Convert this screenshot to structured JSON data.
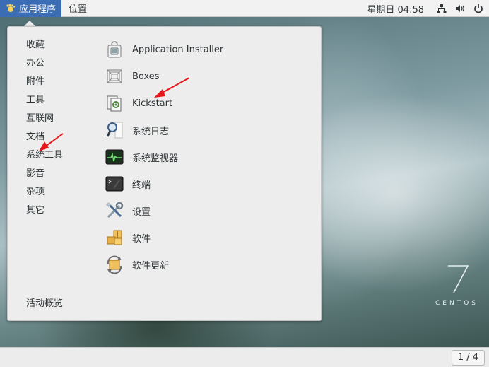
{
  "topbar": {
    "apps_menu_label": "应用程序",
    "places_label": "位置",
    "clock": "星期日 04:58"
  },
  "menu": {
    "categories": [
      "收藏",
      "办公",
      "附件",
      "工具",
      "互联网",
      "文档",
      "系统工具",
      "影音",
      "杂项",
      "其它"
    ],
    "activities": "活动概览",
    "apps": [
      {
        "label": "Application Installer",
        "icon": "software-bag-icon"
      },
      {
        "label": "Boxes",
        "icon": "boxes-icon"
      },
      {
        "label": "Kickstart",
        "icon": "kickstart-icon"
      },
      {
        "label": "系统日志",
        "icon": "log-magnifier-icon"
      },
      {
        "label": "系统监视器",
        "icon": "system-monitor-icon"
      },
      {
        "label": "终端",
        "icon": "terminal-icon"
      },
      {
        "label": "设置",
        "icon": "settings-tools-icon"
      },
      {
        "label": "软件",
        "icon": "software-packages-icon"
      },
      {
        "label": "软件更新",
        "icon": "software-update-icon"
      }
    ]
  },
  "branding": {
    "version": "7",
    "name": "CENTOS"
  },
  "bottombar": {
    "workspace": "1 / 4"
  },
  "colors": {
    "apps_menu_bg": "#3a6db4",
    "menu_bg": "#ededed",
    "annotation_arrow": "#e8171b"
  }
}
